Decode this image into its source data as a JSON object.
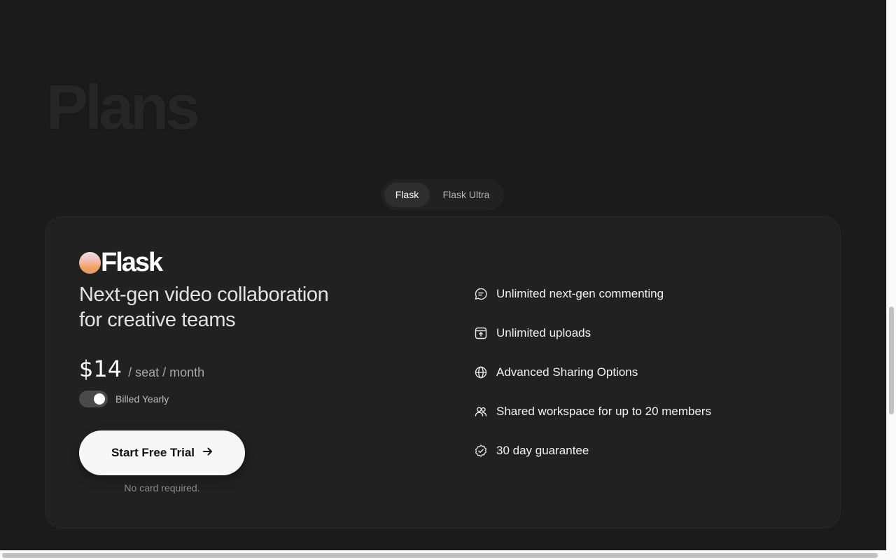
{
  "page": {
    "title": "Plans"
  },
  "plan_switch": {
    "tabs": [
      {
        "label": "Flask",
        "selected": true
      },
      {
        "label": "Flask Ultra",
        "selected": false
      }
    ]
  },
  "card": {
    "brand": "Flask",
    "tagline_line1": "Next-gen video collaboration",
    "tagline_line2": "for creative teams",
    "price": "$14",
    "price_unit": "/ seat / month",
    "billing_label": "Billed Yearly",
    "billing_yearly": true,
    "cta_label": "Start Free Trial",
    "cta_icon": "arrow-right-icon",
    "cta_note": "No card required.",
    "features": [
      {
        "label": "Unlimited next-gen commenting",
        "icon": "comment-icon"
      },
      {
        "label": "Unlimited uploads",
        "icon": "upload-icon"
      },
      {
        "label": "Advanced Sharing Options",
        "icon": "globe-icon"
      },
      {
        "label": "Shared workspace for up to 20 members",
        "icon": "users-icon"
      },
      {
        "label": "30 day guarantee",
        "icon": "badge-check-icon"
      }
    ]
  },
  "colors": {
    "background": "#1b1b1b",
    "card": "#212121",
    "cta_background": "#f7f7f7",
    "brand_gradient": [
      "#e6e2ea",
      "#f3b9a8",
      "#f2a25f"
    ]
  }
}
